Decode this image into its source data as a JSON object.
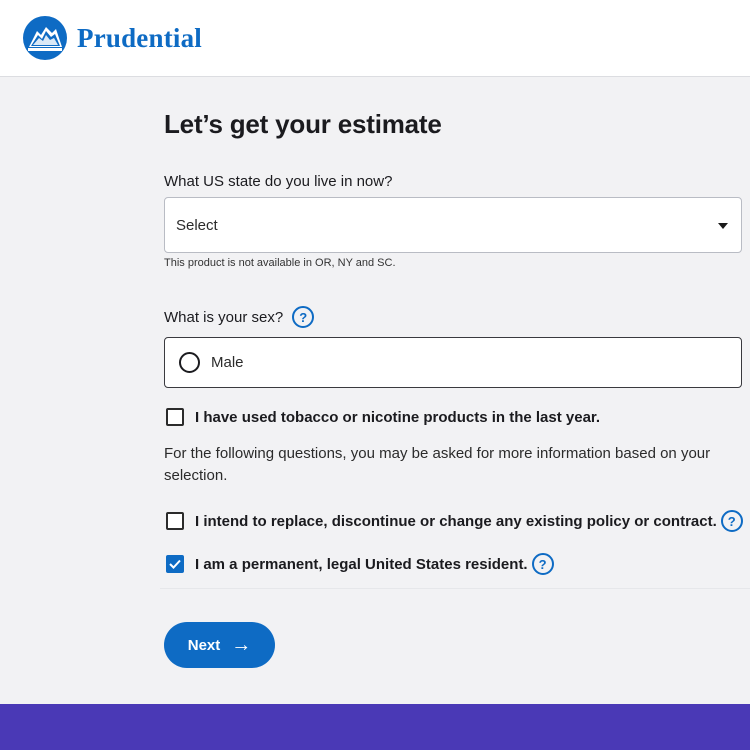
{
  "header": {
    "brand_name": "Prudential",
    "brand_color": "#0e6bc4"
  },
  "form": {
    "title": "Let’s get your estimate",
    "state_question": "What US state do you live in now?",
    "state_select_value": "Select",
    "state_helper": "This product is not available in OR, NY and SC.",
    "sex_question": "What is your sex?",
    "sex_option": "Male",
    "tobacco_label": "I have used tobacco or nicotine products in the last year.",
    "tobacco_checked": false,
    "info_paragraph": "For the following questions, you may be asked for more information based on your selection.",
    "replace_label": "I intend to replace, discontinue or change any existing policy or contract.",
    "replace_checked": false,
    "resident_label": "I am a permanent, legal United States resident.",
    "resident_checked": true,
    "help_glyph": "?",
    "next_label": "Next",
    "next_arrow": "→"
  },
  "icons": {
    "logo": "prudential-rock-icon",
    "help": "question-circle-icon",
    "caret": "chevron-down-icon",
    "arrow": "arrow-right-icon",
    "check": "checkmark-icon"
  },
  "colors": {
    "accent": "#0e6bc4",
    "footer": "#4a39b6",
    "background": "#f2f2f4"
  }
}
